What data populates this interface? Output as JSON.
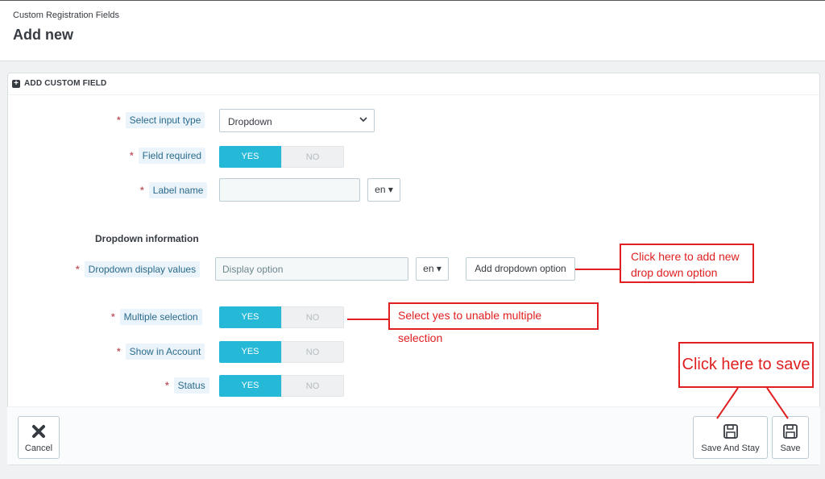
{
  "header": {
    "breadcrumb": "Custom Registration Fields",
    "title": "Add new"
  },
  "panel": {
    "heading": "ADD CUSTOM FIELD",
    "fields": {
      "input_type": {
        "label": "Select input type",
        "value": "Dropdown"
      },
      "field_required": {
        "label": "Field required",
        "yes": "YES",
        "no": "NO",
        "value": "YES"
      },
      "label_name": {
        "label": "Label name",
        "value": "",
        "lang": "en"
      },
      "dropdown_section": "Dropdown information",
      "dropdown_values": {
        "label": "Dropdown display values",
        "placeholder": "Display option",
        "lang": "en",
        "add_button": "Add dropdown option"
      },
      "multiple_selection": {
        "label": "Multiple selection",
        "yes": "YES",
        "no": "NO",
        "value": "YES"
      },
      "show_in_account": {
        "label": "Show in Account",
        "yes": "YES",
        "no": "NO",
        "value": "YES"
      },
      "status": {
        "label": "Status",
        "yes": "YES",
        "no": "NO",
        "value": "YES"
      }
    },
    "footer": {
      "cancel": "Cancel",
      "save_and_stay": "Save And Stay",
      "save": "Save"
    }
  },
  "annotations": {
    "add_option": "Click here to add new drop down option",
    "multiple": "Select yes to unable multiple selection",
    "save": "Click here to save"
  },
  "colors": {
    "toggle_active": "#25b9d7",
    "label_text": "#2b6a8c",
    "required_star": "#c05c67",
    "annotation": "#e02020"
  }
}
